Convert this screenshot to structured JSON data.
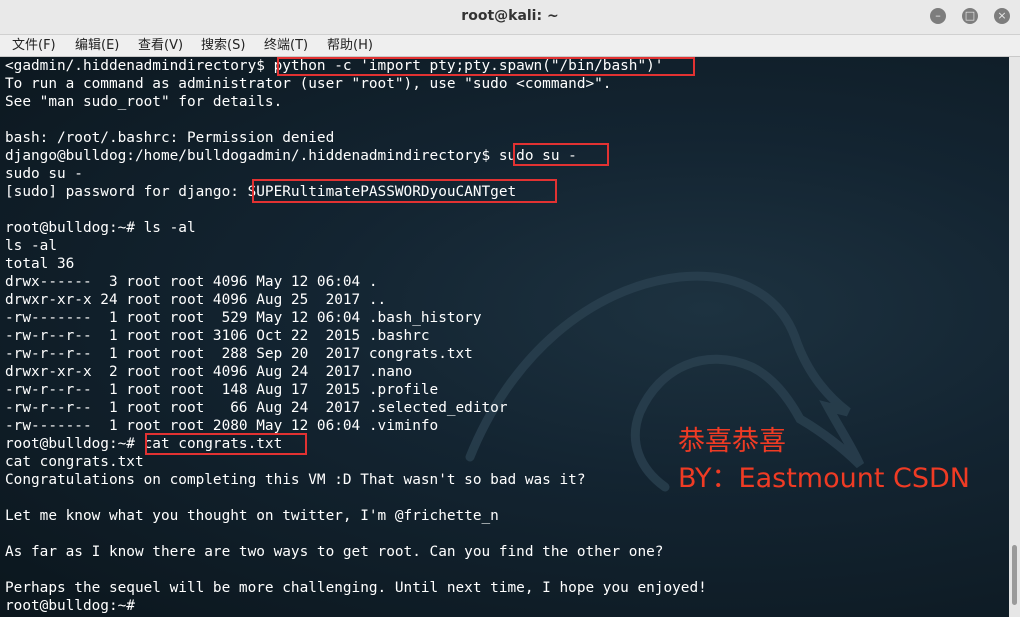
{
  "window": {
    "title": "root@kali: ~"
  },
  "menu": [
    "文件(F)",
    "编辑(E)",
    "查看(V)",
    "搜索(S)",
    "终端(T)",
    "帮助(H)"
  ],
  "terminal": {
    "lines": [
      "<gadmin/.hiddenadmindirectory$ python -c 'import pty;pty.spawn(\"/bin/bash\")'",
      "To run a command as administrator (user \"root\"), use \"sudo <command>\".",
      "See \"man sudo_root\" for details.",
      "",
      "bash: /root/.bashrc: Permission denied",
      "django@bulldog:/home/bulldogadmin/.hiddenadmindirectory$ sudo su -",
      "sudo su -",
      "[sudo] password for django: SUPERultimatePASSWORDyouCANTget",
      "",
      "root@bulldog:~# ls -al",
      "ls -al",
      "total 36",
      "drwx------  3 root root 4096 May 12 06:04 .",
      "drwxr-xr-x 24 root root 4096 Aug 25  2017 ..",
      "-rw-------  1 root root  529 May 12 06:04 .bash_history",
      "-rw-r--r--  1 root root 3106 Oct 22  2015 .bashrc",
      "-rw-r--r--  1 root root  288 Sep 20  2017 congrats.txt",
      "drwxr-xr-x  2 root root 4096 Aug 24  2017 .nano",
      "-rw-r--r--  1 root root  148 Aug 17  2015 .profile",
      "-rw-r--r--  1 root root   66 Aug 24  2017 .selected_editor",
      "-rw-------  1 root root 2080 May 12 06:04 .viminfo",
      "root@bulldog:~# cat congrats.txt",
      "cat congrats.txt",
      "Congratulations on completing this VM :D That wasn't so bad was it?",
      "",
      "Let me know what you thought on twitter, I'm @frichette_n",
      "",
      "As far as I know there are two ways to get root. Can you find the other one?",
      "",
      "Perhaps the sequel will be more challenging. Until next time, I hope you enjoyed!",
      "root@bulldog:~# "
    ]
  },
  "overlay": {
    "line1": "恭喜恭喜",
    "line2": "BY：Eastmount CSDN",
    "color": "#ef3b24"
  },
  "colors": {
    "highlight": "#e23232",
    "text": "#ffffff"
  },
  "icons": {
    "minimize": "minimize-icon",
    "maximize": "maximize-icon",
    "close": "close-icon"
  }
}
